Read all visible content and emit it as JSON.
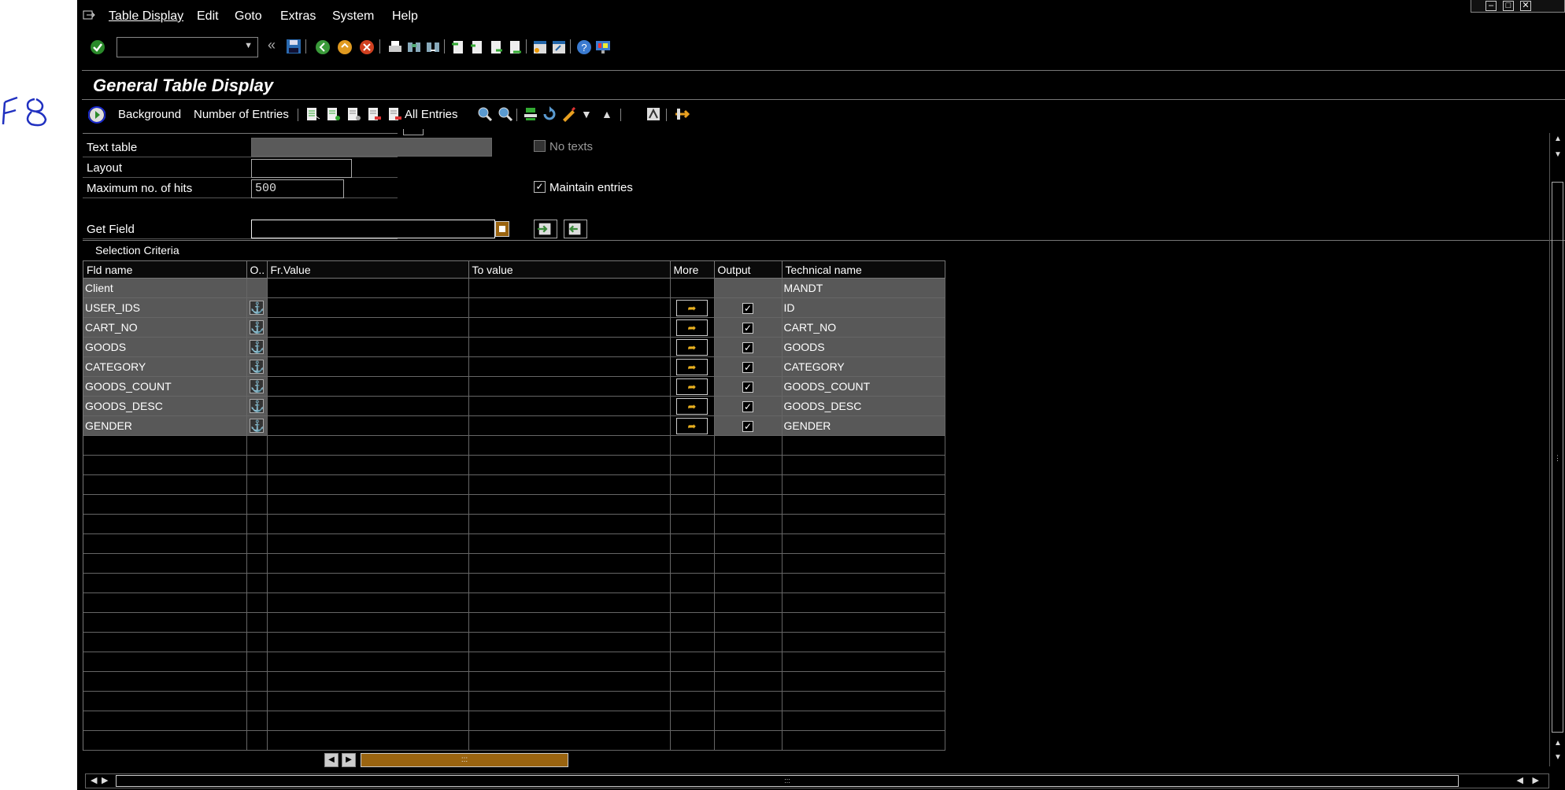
{
  "annotation": {
    "text": "F8"
  },
  "menu": {
    "items": [
      {
        "label": "Table Display"
      },
      {
        "label": "Edit"
      },
      {
        "label": "Goto"
      },
      {
        "label": "Extras"
      },
      {
        "label": "System"
      },
      {
        "label": "Help"
      }
    ]
  },
  "command_field": {
    "value": ""
  },
  "page_title": "General Table Display",
  "app_toolbar": {
    "background_label": "Background",
    "entries_label": "Number of Entries",
    "all_entries_label": "All Entries"
  },
  "fields": {
    "text_table_label": "Text table",
    "text_table_value": "",
    "layout_label": "Layout",
    "layout_value": "",
    "max_hits_label": "Maximum no. of hits",
    "max_hits_value": "500",
    "get_field_label": "Get Field",
    "get_field_value": "",
    "no_texts_label": "No texts",
    "maintain_label": "Maintain entries"
  },
  "selection": {
    "title": "Selection Criteria",
    "columns": [
      "Fld name",
      "O..",
      "Fr.Value",
      "To value",
      "More",
      "Output",
      "Technical name"
    ],
    "rows": [
      {
        "name": "Client",
        "tech": "MANDT",
        "has_icons": false
      },
      {
        "name": "USER_IDS",
        "tech": "ID",
        "has_icons": true
      },
      {
        "name": "CART_NO",
        "tech": "CART_NO",
        "has_icons": true
      },
      {
        "name": "GOODS",
        "tech": "GOODS",
        "has_icons": true
      },
      {
        "name": "CATEGORY",
        "tech": "CATEGORY",
        "has_icons": true
      },
      {
        "name": "GOODS_COUNT",
        "tech": "GOODS_COUNT",
        "has_icons": true
      },
      {
        "name": "GOODS_DESC",
        "tech": "GOODS_DESC",
        "has_icons": true
      },
      {
        "name": "GENDER",
        "tech": "GENDER",
        "has_icons": true
      }
    ]
  }
}
